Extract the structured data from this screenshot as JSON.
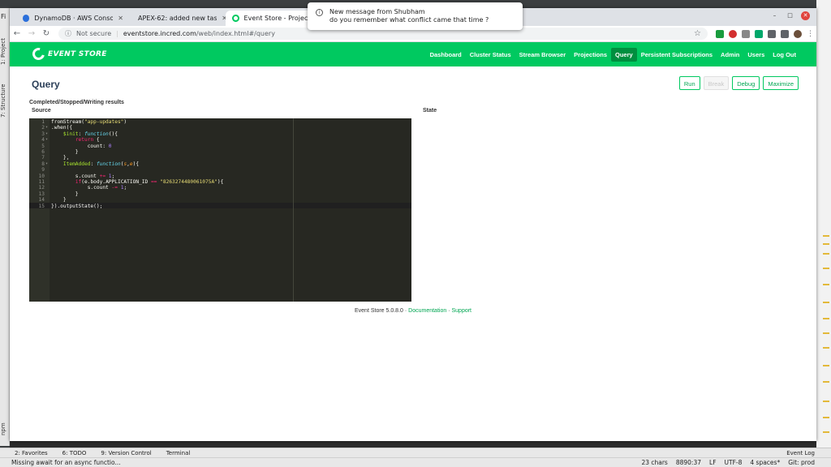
{
  "ide": {
    "top_char": "Fi",
    "left_labels": [
      "1: Project",
      "7: Structure",
      "npm"
    ],
    "tool_windows": [
      "2: Favorites",
      "6: TODO",
      "9: Version Control",
      "Terminal"
    ],
    "event_log": "Event Log",
    "status_message": "Missing await for an async functio...",
    "status_right": [
      "23 chars",
      "8890:37",
      "LF",
      "UTF-8",
      "4 spaces*",
      "Git: prod"
    ]
  },
  "browser": {
    "tabs": [
      {
        "title": "DynamoDB · AWS Console",
        "favicon_color": "#2a6fdb"
      },
      {
        "title": "APEX-62: added new task",
        "favicon_color": "#555555"
      },
      {
        "title": "Event Store - Projection",
        "favicon_color": "#00c960"
      }
    ],
    "address": {
      "security": "Not secure",
      "host": "eventstore.incred.com",
      "path": "/web/index.html#/query"
    }
  },
  "notification": {
    "title": "New message from Shubham",
    "body": "do you remember what conflict came that time ?"
  },
  "eventstore": {
    "logo": "EVENT STORE",
    "nav": [
      {
        "label": "Dashboard",
        "active": false
      },
      {
        "label": "Cluster Status",
        "active": false
      },
      {
        "label": "Stream Browser",
        "active": false
      },
      {
        "label": "Projections",
        "active": false
      },
      {
        "label": "Query",
        "active": true
      },
      {
        "label": "Persistent Subscriptions",
        "active": false
      },
      {
        "label": "Admin",
        "active": false
      },
      {
        "label": "Users",
        "active": false
      },
      {
        "label": "Log Out",
        "active": false
      }
    ],
    "page_title": "Query",
    "actions": {
      "run": "Run",
      "break": "Break",
      "debug": "Debug",
      "maximize": "Maximize"
    },
    "status": "Completed/Stopped/Writing results",
    "source_label": "Source",
    "state_label": "State",
    "code": [
      "fromStream(\"app-updates\")",
      ".when({",
      "    $init: function(){",
      "        return {",
      "            count: 0",
      "        }",
      "    },",
      "    ItemAdded: function(s,e){",
      "",
      "        s.count += 1;",
      "        if(e.body.APPLICATION_ID == \"8263274480061075A\"){",
      "            s.count -= 1;",
      "        }",
      "    }",
      "}).outputState();"
    ],
    "footer": {
      "version": "Event Store 5.0.8.0",
      "docs": "Documentation",
      "support": "Support"
    }
  }
}
